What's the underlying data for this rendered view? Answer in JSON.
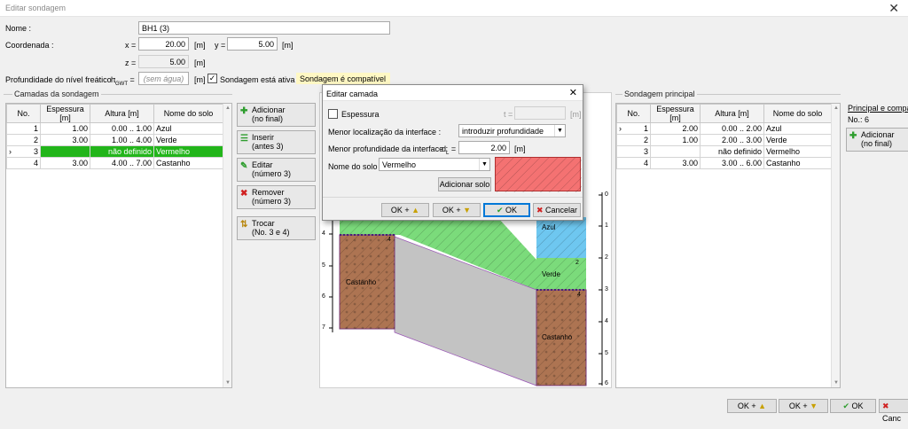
{
  "window": {
    "title": "Editar sondagem",
    "close": "✕"
  },
  "form": {
    "name_label": "Nome :",
    "name_value": "BH1 (3)",
    "coord_label": "Coordenada :",
    "x_label": "x =",
    "x_value": "20.00",
    "y_label": "y =",
    "y_value": "5.00",
    "z_label": "z =",
    "z_value": "5.00",
    "unit_m": "[m]",
    "gwt_label": "Profundidade do nível freático :",
    "gwt_symbol": "h",
    "gwt_sub": "GWT",
    "gwt_eq": "=",
    "gwt_placeholder": "(sem água)",
    "active_label": "Sondagem está ativa",
    "active_checked": true,
    "compat_note": "Sondagem é compatível"
  },
  "left_group": {
    "title": "Camadas da sondagem",
    "columns": [
      "No.",
      "Espessura [m]",
      "Altura [m]",
      "Nome do solo"
    ],
    "rows": [
      {
        "marker": "",
        "no": "1",
        "thickness": "1.00",
        "height": "0.00 .. 1.00",
        "soil": "Azul",
        "selected": false
      },
      {
        "marker": "",
        "no": "2",
        "thickness": "3.00",
        "height": "1.00 .. 4.00",
        "soil": "Verde",
        "selected": false
      },
      {
        "marker": "›",
        "no": "3",
        "thickness": "",
        "height": "não definido",
        "soil": "Vermelho",
        "selected": true
      },
      {
        "marker": "",
        "no": "4",
        "thickness": "3.00",
        "height": "4.00 .. 7.00",
        "soil": "Castanho",
        "selected": false
      }
    ]
  },
  "actions": [
    {
      "name": "add-end-button",
      "icon": "plus-icon",
      "glyph": "✚",
      "color": "#2e9d2e",
      "line1": "Adicionar",
      "line2": "(no final)"
    },
    {
      "name": "insert-button",
      "icon": "insert-rows-icon",
      "glyph": "☰",
      "color": "#2e9d2e",
      "line1": "Inserir",
      "line2": "(antes 3)"
    },
    {
      "name": "edit-button",
      "icon": "pencil-icon",
      "glyph": "✎",
      "color": "#2e9d2e",
      "line1": "Editar",
      "line2": "(número 3)"
    },
    {
      "name": "remove-button",
      "icon": "remove-icon",
      "glyph": "✖",
      "color": "#d02020",
      "line1": "Remover",
      "line2": "(número 3)"
    },
    {
      "name": "swap-button",
      "icon": "swap-icon",
      "glyph": "⇅",
      "color": "#b8860b",
      "line1": "Trocar",
      "line2": "(No. 3 e 4)"
    }
  ],
  "preview": {
    "left_ticks": [
      "4",
      "5",
      "6",
      "7"
    ],
    "right_ticks": [
      "0",
      "1",
      "2",
      "3",
      "4",
      "5",
      "6"
    ],
    "labels": {
      "castanho_left": "Castanho",
      "azul": "Azul",
      "verde": "Verde",
      "castanho_right": "Castanho",
      "n2": "2",
      "n4": "4",
      "n4b": "4"
    }
  },
  "right_group": {
    "title": "Sondagem principal",
    "columns": [
      "No.",
      "Espessura [m]",
      "Altura [m]",
      "Nome do solo"
    ],
    "rows": [
      {
        "marker": "›",
        "no": "1",
        "thickness": "2.00",
        "height": "0.00 .. 2.00",
        "soil": "Azul"
      },
      {
        "marker": "",
        "no": "2",
        "thickness": "1.00",
        "height": "2.00 .. 3.00",
        "soil": "Verde"
      },
      {
        "marker": "",
        "no": "3",
        "thickness": "",
        "height": "não definido",
        "soil": "Vermelho"
      },
      {
        "marker": "",
        "no": "4",
        "thickness": "3.00",
        "height": "3.00 .. 6.00",
        "soil": "Castanho"
      }
    ]
  },
  "far_right": {
    "title": "Principal e compat",
    "count": "No.: 6",
    "add_line1": "Adicionar",
    "add_line2": "(no final)"
  },
  "bottom": {
    "ok_up": "OK +",
    "ok_down": "OK +",
    "ok": "OK",
    "cancel": "Canc"
  },
  "dialog": {
    "title": "Editar camada",
    "close": "✕",
    "thickness_label": "Espessura",
    "t_label": "t =",
    "unit_m": "[m]",
    "interface_label": "Menor localização da interface :",
    "interface_value": "introduzir profundidade",
    "depth_label": "Menor profundidade da interface :",
    "dl_symbol": "d",
    "dl_sub": "L",
    "dl_eq": "=",
    "depth_value": "2.00",
    "soil_label": "Nome do solo :",
    "soil_value": "Vermelho",
    "soil_color": "#f47272",
    "add_soil": "Adicionar solo",
    "ok_up": "OK +",
    "ok_down": "OK +",
    "ok": "OK",
    "cancel": "Cancelar"
  }
}
